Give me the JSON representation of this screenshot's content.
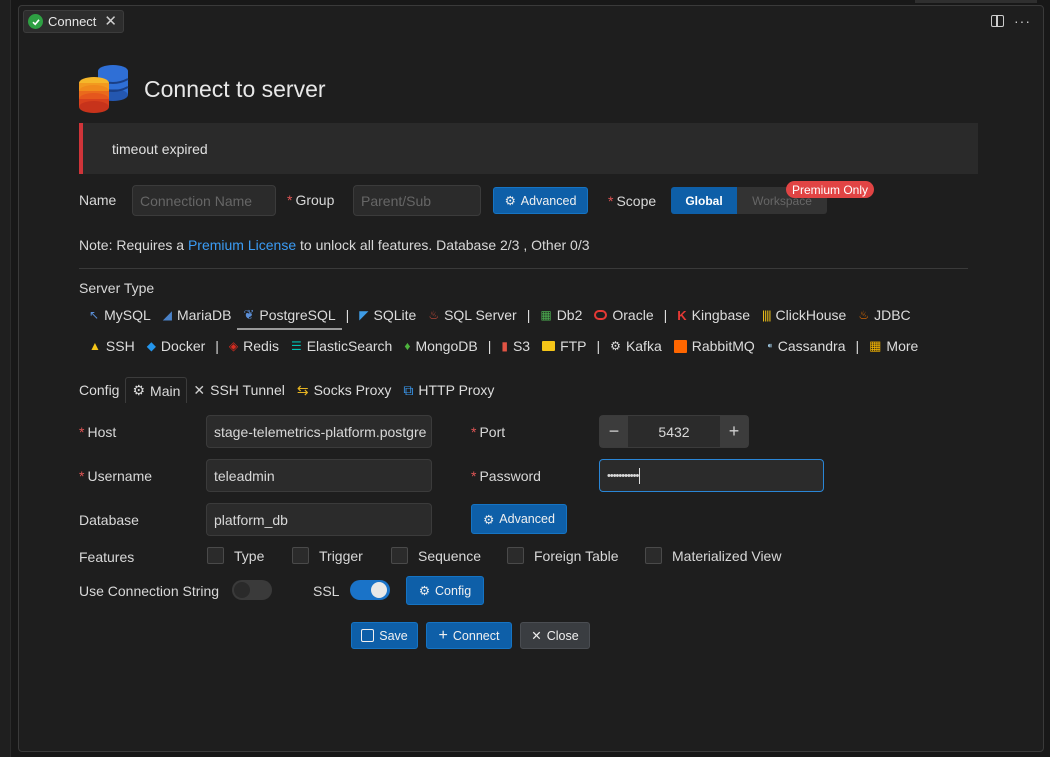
{
  "tab": {
    "label": "Connect"
  },
  "header": {
    "title": "Connect to server"
  },
  "alert": {
    "message": "timeout expired"
  },
  "name_row": {
    "name_label": "Name",
    "name_placeholder": "Connection Name",
    "group_label": "Group",
    "group_placeholder": "Parent/Sub",
    "advanced_label": "Advanced",
    "scope_label": "Scope",
    "scope_global": "Global",
    "scope_workspace": "Workspace",
    "premium_badge": "Premium Only"
  },
  "note": {
    "prefix": "Note: Requires a ",
    "link": "Premium License",
    "suffix": " to unlock all features. Database 2/3 , Other 0/3"
  },
  "server_type": {
    "label": "Server Type",
    "row1": [
      "MySQL",
      "MariaDB",
      "PostgreSQL",
      "SQLite",
      "SQL Server",
      "Db2",
      "Oracle",
      "Kingbase",
      "ClickHouse",
      "JDBC"
    ],
    "row2": [
      "SSH",
      "Docker",
      "Redis",
      "ElasticSearch",
      "MongoDB",
      "S3",
      "FTP",
      "Kafka",
      "RabbitMQ",
      "Cassandra",
      "More"
    ],
    "selected": "PostgreSQL"
  },
  "config": {
    "label": "Config",
    "tabs": [
      "Main",
      "SSH Tunnel",
      "Socks Proxy",
      "HTTP Proxy"
    ]
  },
  "form": {
    "host_label": "Host",
    "host_value": "stage-telemetrics-platform.postgre",
    "port_label": "Port",
    "port_value": "5432",
    "username_label": "Username",
    "username_value": "teleadmin",
    "password_label": "Password",
    "password_value": "•••••••••••",
    "database_label": "Database",
    "database_value": "platform_db",
    "database_advanced": "Advanced",
    "features_label": "Features",
    "features": [
      "Type",
      "Trigger",
      "Sequence",
      "Foreign Table",
      "Materialized View"
    ],
    "use_conn_string_label": "Use Connection String",
    "ssl_label": "SSL",
    "ssl_config": "Config"
  },
  "actions": {
    "save": "Save",
    "connect": "Connect",
    "close": "Close"
  },
  "colors": {
    "accent": "#0e5fa8",
    "alert": "#cf3439",
    "premium": "#e14444"
  }
}
